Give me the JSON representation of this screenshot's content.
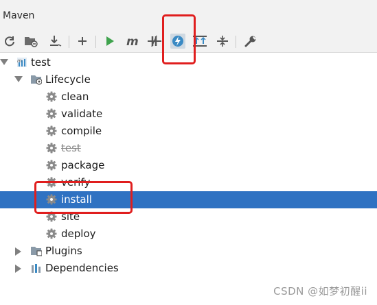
{
  "panel": {
    "title": "Maven"
  },
  "toolbar": {
    "buttons": [
      {
        "name": "reload-icon"
      },
      {
        "name": "add-folder-icon"
      },
      {
        "name": "download-icon"
      },
      {
        "name": "plus-icon"
      },
      {
        "name": "run-icon"
      },
      {
        "name": "maven-goal-icon"
      },
      {
        "name": "toggle-offline-icon"
      },
      {
        "name": "skip-tests-icon"
      },
      {
        "name": "show-dependencies-icon"
      },
      {
        "name": "collapse-all-icon"
      },
      {
        "name": "settings-wrench-icon"
      }
    ]
  },
  "tree": {
    "project": "test",
    "lifecycle": {
      "label": "Lifecycle",
      "goals": [
        "clean",
        "validate",
        "compile",
        "test",
        "package",
        "verify",
        "install",
        "site",
        "deploy"
      ],
      "selected": "install",
      "disabled": "test"
    },
    "plugins": "Plugins",
    "dependencies": "Dependencies"
  },
  "watermark": "CSDN @如梦初醒ii",
  "colors": {
    "selection": "#2f72c2",
    "highlight_box": "#e01e1e",
    "run": "#3fa34d"
  }
}
